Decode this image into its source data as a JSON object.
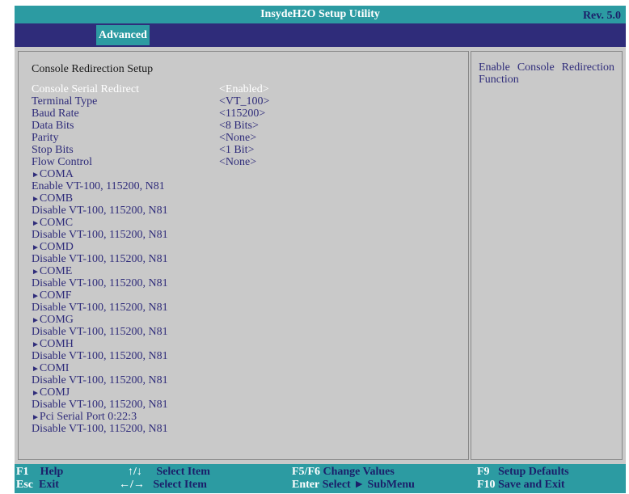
{
  "window": {
    "title": "InsydeH2O Setup Utility",
    "revision": "Rev. 5.0"
  },
  "tabs": [
    {
      "label": "Advanced",
      "active": true
    }
  ],
  "main": {
    "section_title": "Console Redirection Setup",
    "settings": [
      {
        "label": "Console Serial Redirect",
        "value": "<Enabled>",
        "selected": true
      },
      {
        "label": "Terminal Type",
        "value": "<VT_100>"
      },
      {
        "label": "Baud Rate",
        "value": "<115200>"
      },
      {
        "label": "Data Bits",
        "value": "<8 Bits>"
      },
      {
        "label": "Parity",
        "value": "<None>"
      },
      {
        "label": "Stop Bits",
        "value": "<1 Bit>"
      },
      {
        "label": "Flow Control",
        "value": "<None>"
      }
    ],
    "ports": [
      {
        "name": "COMA",
        "status": "Enable VT-100, 115200, N81"
      },
      {
        "name": "COMB",
        "status": "Disable VT-100, 115200, N81"
      },
      {
        "name": "COMC",
        "status": "Disable VT-100, 115200, N81"
      },
      {
        "name": "COMD",
        "status": "Disable VT-100, 115200, N81"
      },
      {
        "name": "COME",
        "status": "Disable VT-100, 115200, N81"
      },
      {
        "name": "COMF",
        "status": "Disable VT-100, 115200, N81"
      },
      {
        "name": "COMG",
        "status": "Disable VT-100, 115200, N81"
      },
      {
        "name": "COMH",
        "status": "Disable VT-100, 115200, N81"
      },
      {
        "name": "COMI",
        "status": "Disable VT-100, 115200, N81"
      },
      {
        "name": "COMJ",
        "status": "Disable VT-100, 115200, N81"
      },
      {
        "name": "Pci Serial Port 0:22:3",
        "status": "Disable VT-100, 115200, N81"
      }
    ]
  },
  "help": {
    "text": "Enable Console Redirection Function"
  },
  "footer": {
    "keys": [
      {
        "key": "F1",
        "desc": "Help"
      },
      {
        "key": "Esc",
        "desc": "Exit"
      },
      {
        "key": "↑/↓",
        "desc": "Select Item"
      },
      {
        "key": "←/→",
        "desc": "Select Item"
      },
      {
        "key": "F5/F6",
        "desc": "Change Values"
      },
      {
        "key": "Enter",
        "desc": "Select ► SubMenu"
      },
      {
        "key": "F9",
        "desc": "Setup Defaults"
      },
      {
        "key": "F10",
        "desc": "Save and Exit"
      }
    ]
  },
  "colors": {
    "accent": "#2c9ba2",
    "navy": "#2f2c7a",
    "panel": "#c9c9c9"
  },
  "icons": {
    "submenu": "triangle-right-icon"
  }
}
